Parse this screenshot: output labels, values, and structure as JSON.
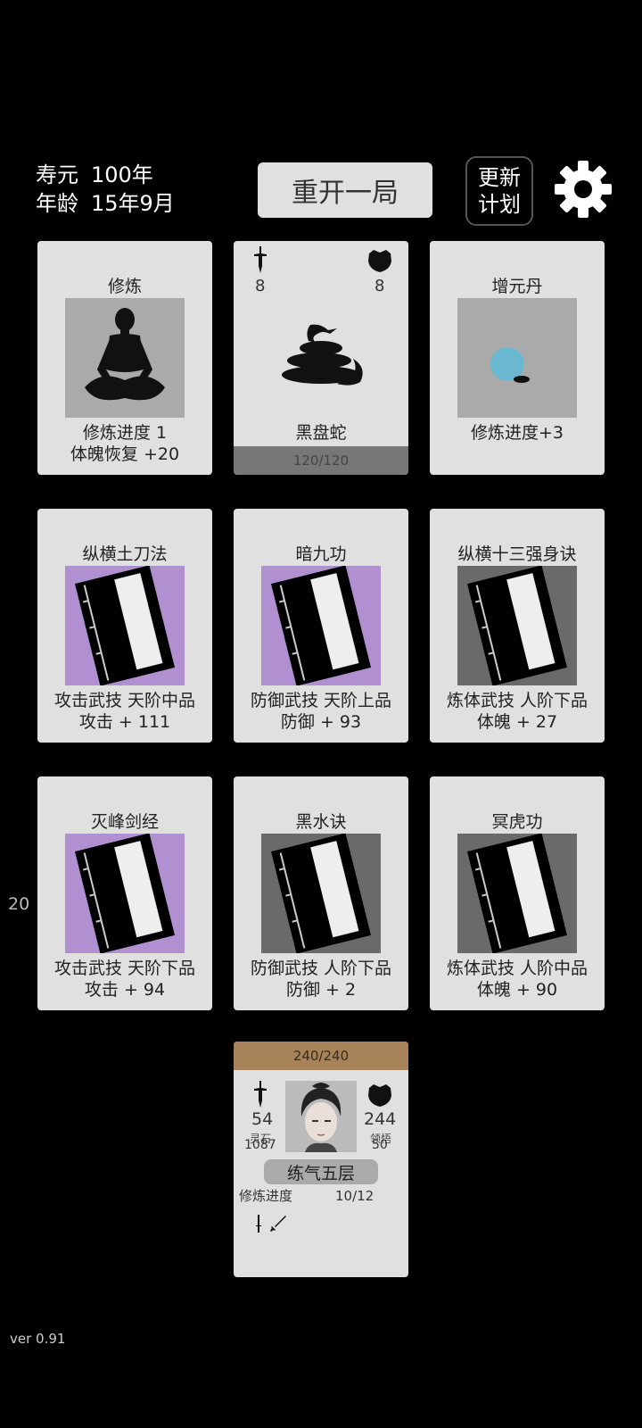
{
  "header": {
    "lifespan_label": "寿元",
    "lifespan_value": "100年",
    "age_label": "年龄",
    "age_value": "15年9月",
    "restart_label": "重开一局",
    "update_line1": "更新",
    "update_line2": "计划",
    "settings_icon": "gear-icon"
  },
  "cards": {
    "cultivate": {
      "title": "修炼",
      "line1": "修炼进度  1",
      "line2": "体魄恢复  +20",
      "icon": "meditation-icon"
    },
    "enemy": {
      "attack": "8",
      "defense": "8",
      "name": "黑盘蛇",
      "hp": "120/120",
      "icon": "snake-icon"
    },
    "pill": {
      "title": "增元丹",
      "line1": "修炼进度+3",
      "icon": "pill-icon"
    },
    "book1": {
      "title": "纵横土刀法",
      "line1": "攻击武技  天阶中品",
      "line2": "攻击 + 111",
      "bg": "#b090d0"
    },
    "book2": {
      "title": "暗九功",
      "line1": "防御武技  天阶上品",
      "line2": "防御 + 93",
      "bg": "#b090d0"
    },
    "book3": {
      "title": "纵横十三强身诀",
      "line1": "炼体武技  人阶下品",
      "line2": "体魄 + 27",
      "bg": "#6a6a6a"
    },
    "book4": {
      "title": "灭峰剑经",
      "line1": "攻击武技  天阶下品",
      "line2": "攻击 + 94",
      "bg": "#b090d0"
    },
    "book5": {
      "title": "黑水诀",
      "line1": "防御武技  人阶下品",
      "line2": "防御 + 2",
      "bg": "#6a6a6a"
    },
    "book6": {
      "title": "冥虎功",
      "line1": "炼体武技  人阶中品",
      "line2": "体魄 + 90",
      "bg": "#6a6a6a"
    }
  },
  "player": {
    "hp": "240/240",
    "attack": "54",
    "spirit_stone_label": "灵石",
    "spirit_stone": "1087",
    "defense": "244",
    "insight_label": "领悟",
    "insight": "50",
    "realm": "练气五层",
    "progress_label": "修炼进度",
    "progress_value": "10/12"
  },
  "side_number": "20",
  "version": "ver 0.91"
}
